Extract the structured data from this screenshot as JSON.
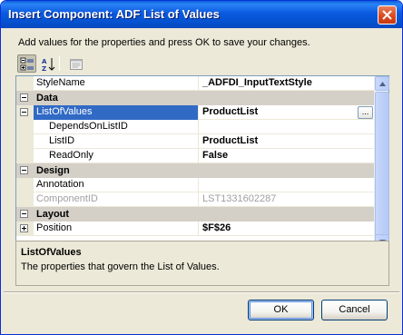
{
  "window": {
    "title": "Insert Component: ADF List of Values"
  },
  "instruction": "Add values for the properties and press OK to save your changes.",
  "toolbar": {
    "categorized_icon": "categorized-icon",
    "alphabetical_icon": "alphabetical-az-icon",
    "property_pages_icon": "property-pages-icon"
  },
  "grid": {
    "rows": [
      {
        "name": "StyleName",
        "value": "_ADFDI_InputTextStyle"
      },
      {
        "category": "Data"
      },
      {
        "name": "ListOfValues",
        "value": "ProductList",
        "button": "..."
      },
      {
        "name": "DependsOnListID",
        "value": ""
      },
      {
        "name": "ListID",
        "value": "ProductList"
      },
      {
        "name": "ReadOnly",
        "value": "False"
      },
      {
        "category": "Design"
      },
      {
        "name": "Annotation",
        "value": ""
      },
      {
        "name": "ComponentID",
        "value": "LST1331602287"
      },
      {
        "category": "Layout"
      },
      {
        "name": "Position",
        "value": "$F$26"
      }
    ]
  },
  "description": {
    "title": "ListOfValues",
    "text": "The properties that govern the List of Values."
  },
  "buttons": {
    "ok": "OK",
    "cancel": "Cancel"
  },
  "colors": {
    "title_bar": "#0553d1",
    "selection": "#316ac5",
    "dialog_bg": "#ece9d8"
  }
}
